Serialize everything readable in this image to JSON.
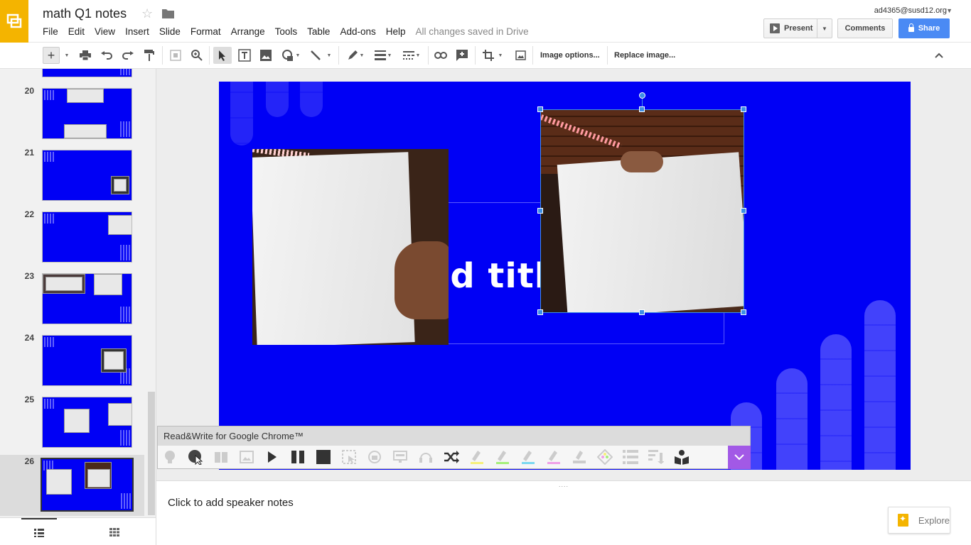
{
  "header": {
    "doc_title": "math Q1 notes",
    "star_icon": "☆",
    "account": "ad4365@susd12.org",
    "menu": [
      "File",
      "Edit",
      "View",
      "Insert",
      "Slide",
      "Format",
      "Arrange",
      "Tools",
      "Table",
      "Add-ons",
      "Help"
    ],
    "save_status": "All changes saved in Drive",
    "present_label": "Present",
    "comments_label": "Comments",
    "share_label": "Share"
  },
  "toolbar": {
    "image_options": "Image options...",
    "replace_image": "Replace image...",
    "new_slide_icon": "+"
  },
  "filmstrip": {
    "slides": [
      {
        "num": "20"
      },
      {
        "num": "21"
      },
      {
        "num": "22"
      },
      {
        "num": "23"
      },
      {
        "num": "24"
      },
      {
        "num": "25"
      },
      {
        "num": "26",
        "selected": true
      }
    ]
  },
  "slide": {
    "title_placeholder": "dd titl"
  },
  "readwrite": {
    "title": "Read&Write for Google Chrome™"
  },
  "notes": {
    "placeholder": "Click to add speaker notes",
    "grip": "....",
    "explore_label": "Explore"
  },
  "colors": {
    "slide_bg": "#0000f5",
    "accent": "#4a8af4",
    "selection": "#3d8ee6",
    "slides_logo": "#f4b400",
    "rw_purple": "#a259e6"
  }
}
